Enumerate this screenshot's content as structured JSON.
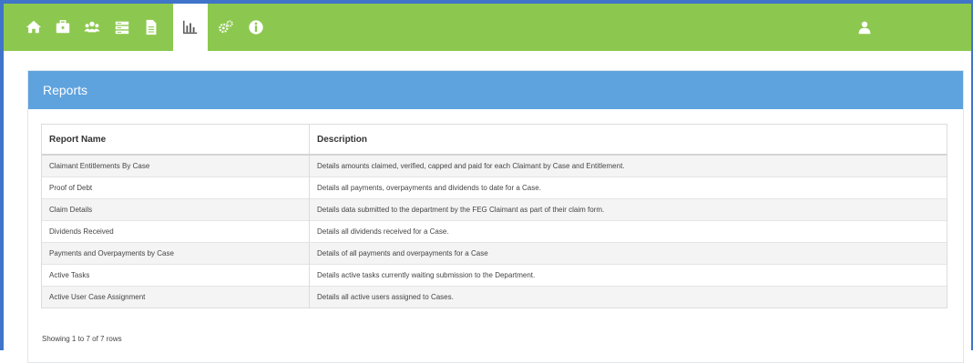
{
  "colors": {
    "navbar": "#8cc84f",
    "panel_header": "#5ea2de",
    "frame": "#3f74c9"
  },
  "nav": {
    "items": [
      {
        "icon": "home-icon"
      },
      {
        "icon": "briefcase-icon"
      },
      {
        "icon": "users-icon"
      },
      {
        "icon": "list-icon"
      },
      {
        "icon": "document-icon"
      },
      {
        "icon": "bar-chart-icon",
        "active": true
      },
      {
        "icon": "gears-icon"
      },
      {
        "icon": "info-icon"
      }
    ],
    "user_icon": "user-icon"
  },
  "panel": {
    "title": "Reports"
  },
  "table": {
    "headers": [
      "Report Name",
      "Description"
    ],
    "rows": [
      [
        "Claimant Entitlements By Case",
        "Details amounts claimed, verified, capped and paid for each Claimant by Case and Entitlement."
      ],
      [
        "Proof of Debt",
        "Details all payments, overpayments and dividends to date for a Case."
      ],
      [
        "Claim Details",
        "Details data submitted to the department by the FEG Claimant as part of their claim form."
      ],
      [
        "Dividends Received",
        "Details all dividends received for a Case."
      ],
      [
        "Payments and Overpayments by Case",
        "Details of all payments and overpayments for a Case"
      ],
      [
        "Active Tasks",
        "Details active tasks currently waiting submission to the Department."
      ],
      [
        "Active User Case Assignment",
        "Details all active users assigned to Cases."
      ]
    ]
  },
  "footer": {
    "pagination_text": "Showing 1 to 7 of 7 rows"
  }
}
